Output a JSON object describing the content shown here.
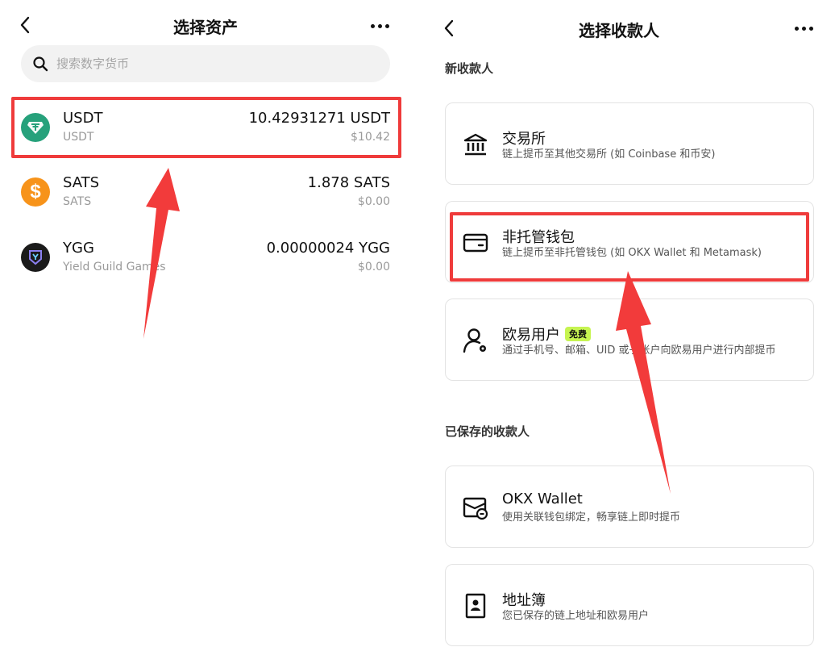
{
  "left": {
    "title": "选择资产",
    "search_placeholder": "搜索数字货币",
    "assets": [
      {
        "symbol": "USDT",
        "name": "USDT",
        "amount": "10.42931271 USDT",
        "usd": "$10.42",
        "icon": "tether-icon",
        "color": "#26a17b"
      },
      {
        "symbol": "SATS",
        "name": "SATS",
        "amount": "1.878 SATS",
        "usd": "$0.00",
        "icon": "dollar-coin-icon",
        "color": "#f7931a"
      },
      {
        "symbol": "YGG",
        "name": "Yield Guild Games",
        "amount": "0.00000024 YGG",
        "usd": "$0.00",
        "icon": "ygg-shield-icon",
        "color": "#1b1b1b"
      }
    ]
  },
  "right": {
    "title": "选择收款人",
    "new_section": "新收款人",
    "saved_section": "已保存的收款人",
    "options": [
      {
        "title": "交易所",
        "desc": "链上提币至其他交易所 (如 Coinbase 和币安)",
        "icon": "bank-icon"
      },
      {
        "title": "非托管钱包",
        "desc": "链上提币至非托管钱包 (如 OKX Wallet 和 Metamask)",
        "icon": "wallet-icon"
      },
      {
        "title": "欧易用户",
        "badge": "免费",
        "desc": "通过手机号、邮箱、UID 或子账户向欧易用户进行内部提币",
        "icon": "user-gear-icon"
      }
    ],
    "saved": [
      {
        "title": "OKX Wallet",
        "desc": "使用关联钱包绑定，畅享链上即时提币",
        "icon": "okx-wallet-icon"
      },
      {
        "title": "地址簿",
        "desc": "您已保存的链上地址和欧易用户",
        "icon": "address-book-icon"
      }
    ]
  },
  "colors": {
    "highlight": "#ef3b3b",
    "badge": "#c6f451"
  }
}
